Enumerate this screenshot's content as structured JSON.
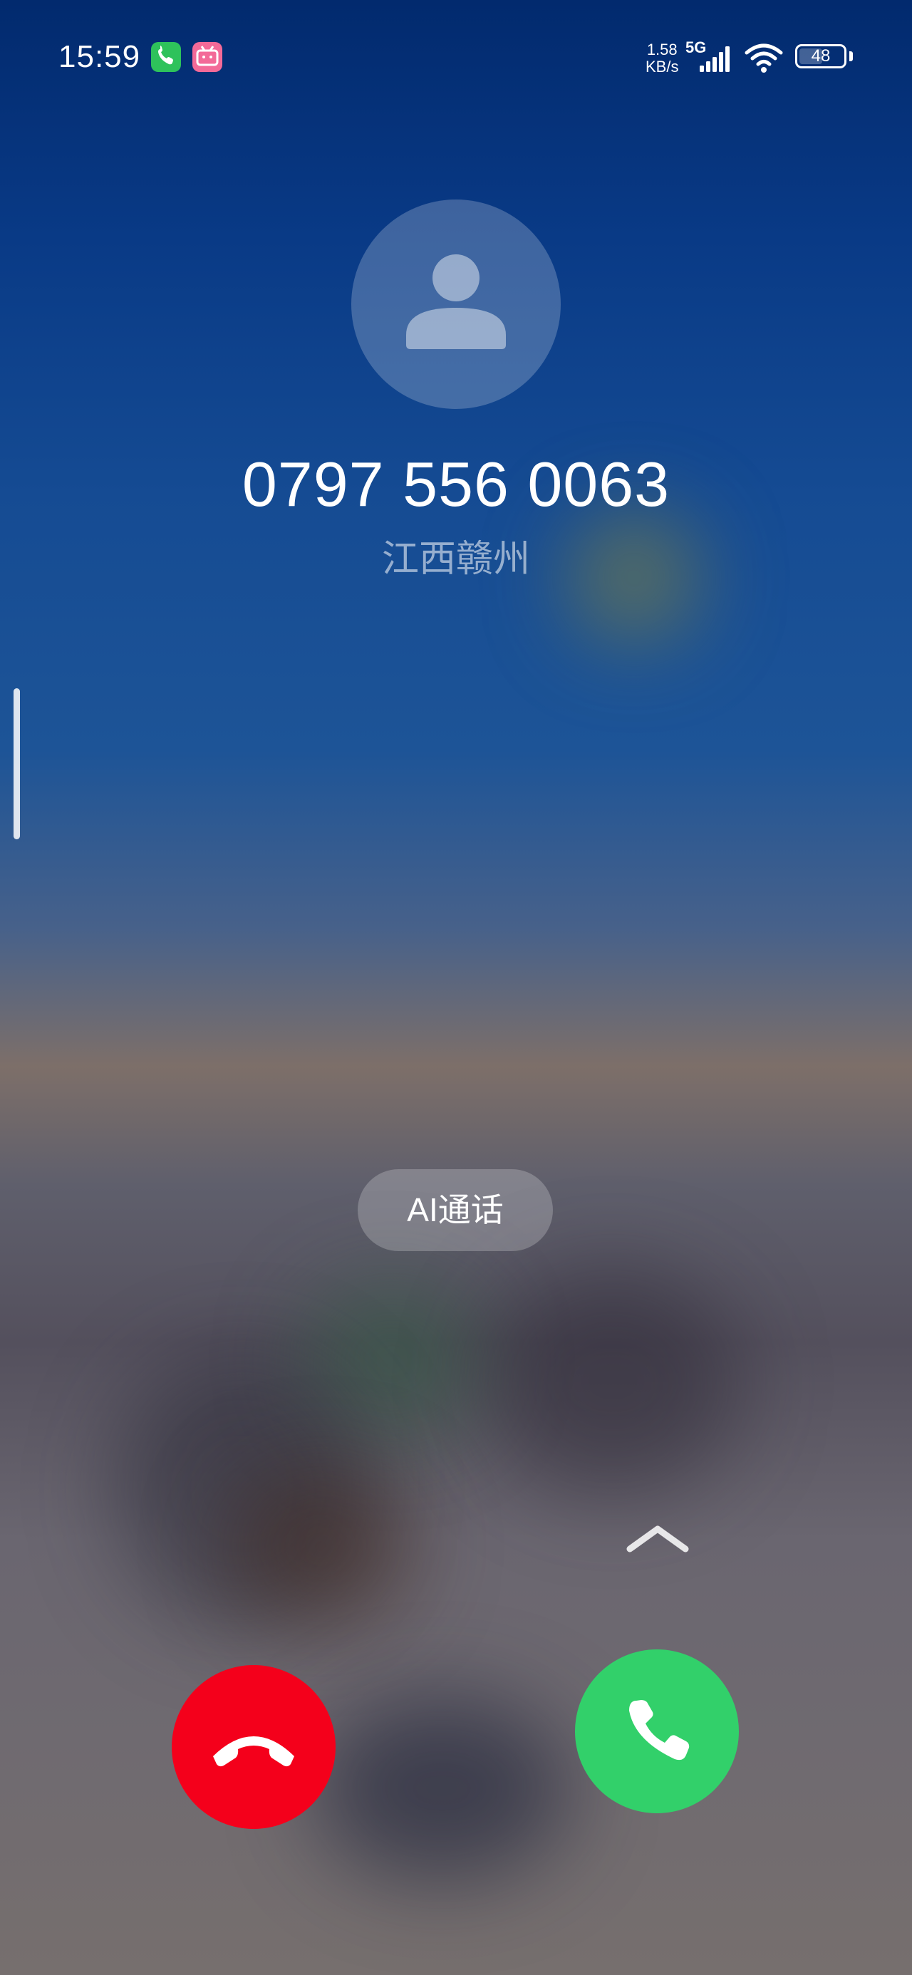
{
  "status_bar": {
    "time": "15:59",
    "app_icons": [
      "phone-icon",
      "bilibili-icon"
    ],
    "net_speed_value": "1.58",
    "net_speed_unit": "KB/s",
    "network_type": "5G",
    "signal_icon": "signal-bars-icon",
    "wifi_icon": "wifi-icon",
    "battery_level": "48"
  },
  "caller": {
    "avatar_icon": "person-icon",
    "number": "0797 556 0063",
    "location": "江西赣州"
  },
  "actions": {
    "ai_call_label": "AI通话",
    "swipe_up_icon": "chevron-up-icon",
    "decline_icon": "hang-up-icon",
    "answer_icon": "phone-answer-icon"
  },
  "colors": {
    "decline": "#f4001b",
    "answer": "#32d06a"
  }
}
